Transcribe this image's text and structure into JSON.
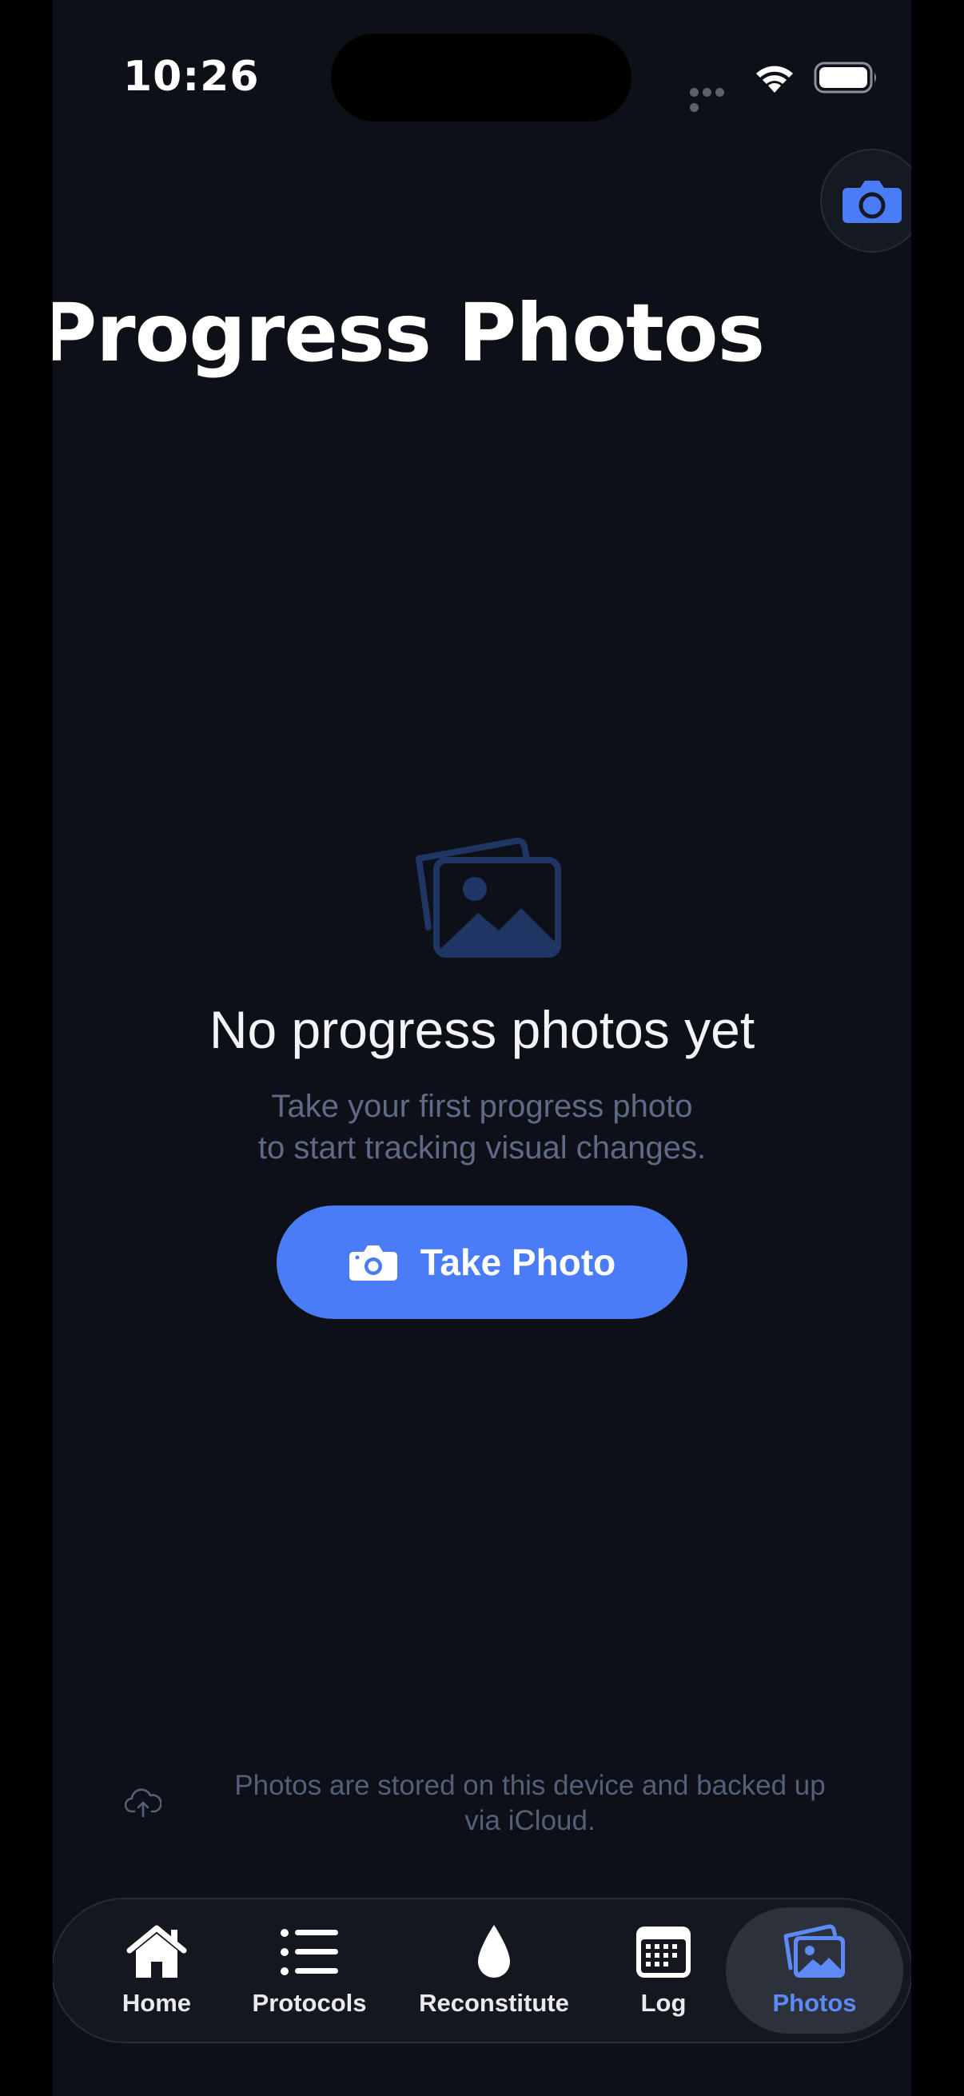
{
  "status_bar": {
    "time": "10:26"
  },
  "header": {
    "title": "Progress Photos",
    "camera_icon": "camera-icon"
  },
  "empty_state": {
    "icon": "photo-stack-icon",
    "title": "No progress photos yet",
    "subtitle_line1": "Take your first progress photo",
    "subtitle_line2": "to start tracking visual changes.",
    "button_label": "Take Photo"
  },
  "storage_note": {
    "icon": "cloud-upload-icon",
    "line1": "Photos are stored on this device and backed up",
    "line2": "via iCloud."
  },
  "tab_bar": {
    "tabs": [
      {
        "label": "Home",
        "icon": "house-icon"
      },
      {
        "label": "Protocols",
        "icon": "list-icon"
      },
      {
        "label": "Reconstitute",
        "icon": "drop-icon"
      },
      {
        "label": "Log",
        "icon": "calendar-icon"
      },
      {
        "label": "Photos",
        "icon": "photos-icon",
        "selected": true
      }
    ]
  },
  "colors": {
    "background": "#0d1017",
    "accent": "#4b7cf7",
    "muted_icon": "#1f3563",
    "muted_text": "#5f6b86"
  }
}
